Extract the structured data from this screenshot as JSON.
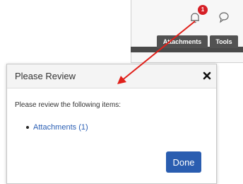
{
  "app": {
    "notification_count": "1",
    "tabs": [
      "Attachments",
      "Tools"
    ]
  },
  "dialog": {
    "title": "Please Review",
    "message": "Please review the following items:",
    "items": [
      {
        "label": "Attachments (1)"
      }
    ],
    "done_label": "Done"
  },
  "icons": {
    "bell": "bell-icon",
    "chat": "chat-bubble-icon",
    "close": "close-icon"
  },
  "colors": {
    "accent_blue": "#2a5db0",
    "link_blue": "#2b5fb4",
    "badge_red": "#d61f26",
    "annotation_arrow": "#e0201a",
    "tab_dark": "#525252"
  }
}
